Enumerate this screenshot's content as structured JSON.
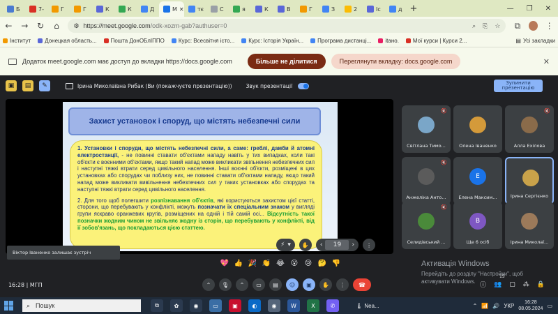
{
  "browser": {
    "tabs": [
      {
        "label": "Б",
        "color": "#4a7bd0"
      },
      {
        "label": "7-",
        "color": "#d93025"
      },
      {
        "label": "Г",
        "color": "#f29900"
      },
      {
        "label": "Г",
        "color": "#f29900"
      },
      {
        "label": "К",
        "color": "#5a67d8"
      },
      {
        "label": "К",
        "color": "#34a853"
      },
      {
        "label": "Д",
        "color": "#4285f4"
      },
      {
        "label": "M",
        "color": "#1a73e8",
        "active": true
      },
      {
        "label": "тє",
        "color": "#4285f4"
      },
      {
        "label": "С",
        "color": "#9aa0a6"
      },
      {
        "label": "я",
        "color": "#34a853"
      },
      {
        "label": "К",
        "color": "#5a67d8"
      },
      {
        "label": "В",
        "color": "#5a67d8"
      },
      {
        "label": "Г",
        "color": "#f29900"
      },
      {
        "label": "З",
        "color": "#4285f4"
      },
      {
        "label": "2",
        "color": "#fbbc04"
      },
      {
        "label": "Іс",
        "color": "#5a67d8"
      },
      {
        "label": "д",
        "color": "#4285f4"
      }
    ],
    "new_tab": "+",
    "url_main": "https://meet.google.com",
    "url_rest": "/odk-xozm-gab?authuser=0",
    "bookmarks": [
      {
        "label": "Інститут",
        "color": "#f29900"
      },
      {
        "label": "Донецкая область...",
        "color": "#5a67d8"
      },
      {
        "label": "Пошта ДонОБлІППО",
        "color": "#d93025"
      },
      {
        "label": "Курс: Всесвітня істо...",
        "color": "#4285f4"
      },
      {
        "label": "Курс: Історія Україн...",
        "color": "#4285f4"
      },
      {
        "label": "Програма дистанці...",
        "color": "#4285f4"
      },
      {
        "label": "itано.",
        "color": "#e91e63"
      },
      {
        "label": "Мої курси | Курси 2...",
        "color": "#d93025"
      }
    ],
    "all_bookmarks": "Усі закладки"
  },
  "banner": {
    "text": "Додаток meet.google.com має доступ до вкладки https://docs.google.com",
    "stop_button": "Більше не ділитися",
    "view_button": "Переглянути вкладку: docs.google.com"
  },
  "meet": {
    "presenter_text": "Ірина Миколаївна Рибак (Ви (покажчуєте презентацію))",
    "sound_label": "Звук презентації",
    "stop_presenting": "Зупинити презентацію",
    "toast": "Віктор Іваненко залишає зустріч",
    "page_number": "19",
    "meeting_code": "МГП",
    "time": "16:28",
    "participants_count": "15"
  },
  "slide": {
    "title": "Захист установок і споруд, що містять  небезпечні сили",
    "p1_part1": "1. Установки і споруди, що містять небезпечні сили, а саме:  греблі, дамби й атомні електростанції,",
    "p1_part2": " - не повинні ставати  об'єктами нападу навіть у тих випадках, коли такі об'єкти є  воєнними об'єктами, якщо такий напад може викликати звільнення  небезпечних сил і наступні тяжкі втрати серед цивільного  населення. Інші воєнні об'єкти, розміщені в цих установках або  спорудах чи поблизу них, не повинні ставати об'єктами нападу, якщо такий напад може викликати вивільнення небезпечних сил у таких  установках або спорудах та наступні тяжкі втрати серед цивільного  населення.",
    "p2_part1": "2.  Для того щоб полегшити ",
    "p2_hl1": "розпізнавання об'єктів",
    "p2_part2": ", які користуються захистом цієї статті, сторони, що перебувають у конфлікті, можуть ",
    "p2_hl2": "позначати їх спеціальним знаком",
    "p2_part3": " у вигляді групи яскраво оранжевих кругів, розміщених на одній і тій самій осі... ",
    "p2_hl3": "Відсутність  такої позначки жодним чином не звільняє жодну із сторін, що перебувають у конфлікті, від її зобов'язань, що покладаються цією  статтею."
  },
  "participants": [
    {
      "name": "Світлана Тимо...",
      "avatar_color": "#7aa6c8",
      "initial": "",
      "muted": true
    },
    {
      "name": "Олена Іваненко",
      "avatar_color": "#d49a3a",
      "initial": "",
      "muted": false
    },
    {
      "name": "Алла Ехілова",
      "avatar_color": "#8a6b4a",
      "initial": "",
      "muted": true
    },
    {
      "name": "Анжеліка Анто...",
      "avatar_color": "#5b5b5b",
      "initial": "",
      "muted": true
    },
    {
      "name": "Елена Максим...",
      "avatar_color": "#1a73e8",
      "initial": "Е",
      "muted": false
    },
    {
      "name": "Ірина Сергієнко",
      "avatar_color": "#c9a24a",
      "initial": "",
      "muted": false
    },
    {
      "name": "Селидівський ...",
      "avatar_color": "#4a8a3a",
      "initial": "",
      "muted": true
    },
    {
      "name": "Ще 6 осіб",
      "avatar_color": "#7e57c2",
      "initial": "В",
      "muted": false
    },
    {
      "name": "Ірина Миколаї...",
      "avatar_color": "#9c7a5a",
      "initial": "",
      "muted": false
    }
  ],
  "reactions": [
    "💖",
    "👍",
    "🎉",
    "👏",
    "😂",
    "😮",
    "😢",
    "🤔",
    "👎"
  ],
  "watermark": {
    "title": "Активація Windows",
    "text": "Перейдіть до розділу \"Настройки\", щоб активувати Windows."
  },
  "taskbar": {
    "search": "Пошук",
    "weather": "Nea...",
    "lang": "УКР",
    "time": "16:28",
    "date": "08.05.2024"
  }
}
